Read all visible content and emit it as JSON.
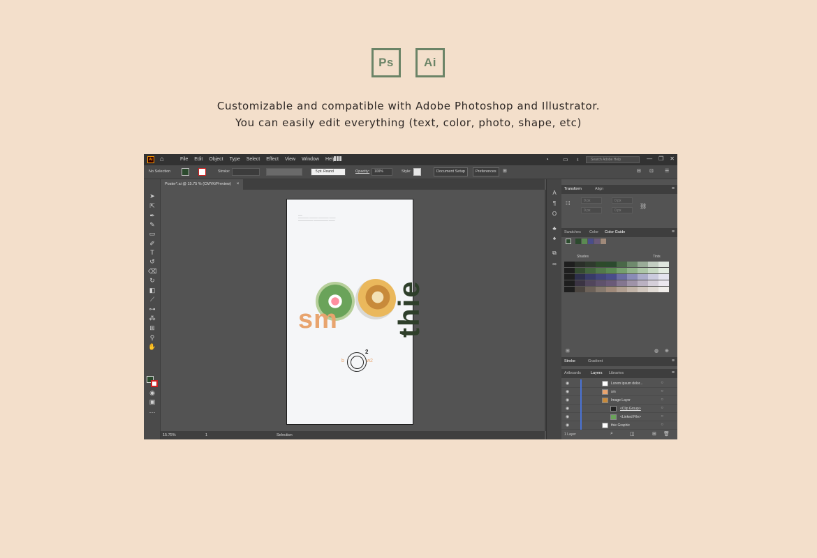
{
  "header": {
    "badges": [
      {
        "label": "Ps"
      },
      {
        "label": "Ai"
      }
    ],
    "tagline_line1": "Customizable and compatible with Adobe Photoshop and Illustrator.",
    "tagline_line2": "You can easily edit everything (text, color, photo, shape, etc)"
  },
  "app": {
    "logo_label": "Ai",
    "menu": [
      "File",
      "Edit",
      "Object",
      "Type",
      "Select",
      "Effect",
      "View",
      "Window",
      "Help"
    ],
    "search_placeholder": "Search Adobe Help",
    "window_controls": [
      "—",
      "❐",
      "✕"
    ]
  },
  "control_bar": {
    "selection_label": "No Selection",
    "stroke_label": "Stroke:",
    "brush_label": "5 pt. Round",
    "opacity_label": "Opacity:",
    "opacity_value": "100%",
    "style_label": "Style:",
    "document_setup": "Document Setup",
    "preferences": "Preferences"
  },
  "document": {
    "tab_title": "Poster*.ai @ 15.75 % (CMYK/Preview)",
    "tab_close": "×"
  },
  "artwork": {
    "sm_text": "sm",
    "thie_text": "thie",
    "logo_sup": "2",
    "logo_left": "b",
    "logo_right": "w2"
  },
  "status_bar": {
    "zoom": "15.75%",
    "artboard_no": "1",
    "tool": "Selection"
  },
  "panels": {
    "transform_tabs": [
      "Transform",
      "Align"
    ],
    "transform_fields": {
      "x": "0 px",
      "y": "0 px",
      "w": "0 px",
      "h": "0 px"
    },
    "color_tabs": [
      "Swatches",
      "Color",
      "Color Guide"
    ],
    "guide_mode": "Shades",
    "guide_right": "Tints",
    "stroke_tabs": [
      "Stroke",
      "Gradient"
    ],
    "layer_tabs": [
      "Artboards",
      "Layers",
      "Libraries"
    ],
    "layers": [
      "Lorem ipsum dolor...",
      "sm",
      "Image Layer",
      "<Clip Group>",
      "<Linked File>",
      "thie Graphic"
    ],
    "layers_count": "1 Layer"
  },
  "colors": {
    "background": "#f3dfcb",
    "badge": "#6b8467",
    "accent_orange": "#e8a46e",
    "accent_green": "#2e3f2a"
  }
}
